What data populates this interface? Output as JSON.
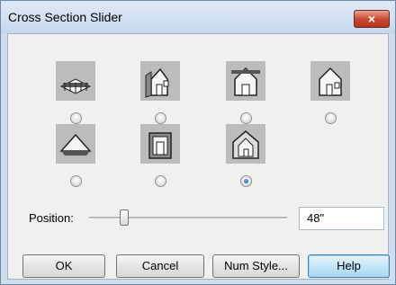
{
  "window": {
    "title": "Cross Section Slider",
    "close_label": "×"
  },
  "options": [
    {
      "icon": "roof-section-icon",
      "checked": false
    },
    {
      "icon": "house-front-cut-icon",
      "checked": false
    },
    {
      "icon": "house-side-cut-icon",
      "checked": false
    },
    {
      "icon": "house-full-icon",
      "checked": false
    },
    {
      "icon": "house-roof-cut-icon",
      "checked": false
    },
    {
      "icon": "wall-section-icon",
      "checked": false
    },
    {
      "icon": "house-interior-cut-icon",
      "checked": true
    }
  ],
  "position": {
    "label": "Position:",
    "value": "48\""
  },
  "buttons": {
    "ok": "OK",
    "cancel": "Cancel",
    "num_style": "Num Style...",
    "help": "Help"
  }
}
